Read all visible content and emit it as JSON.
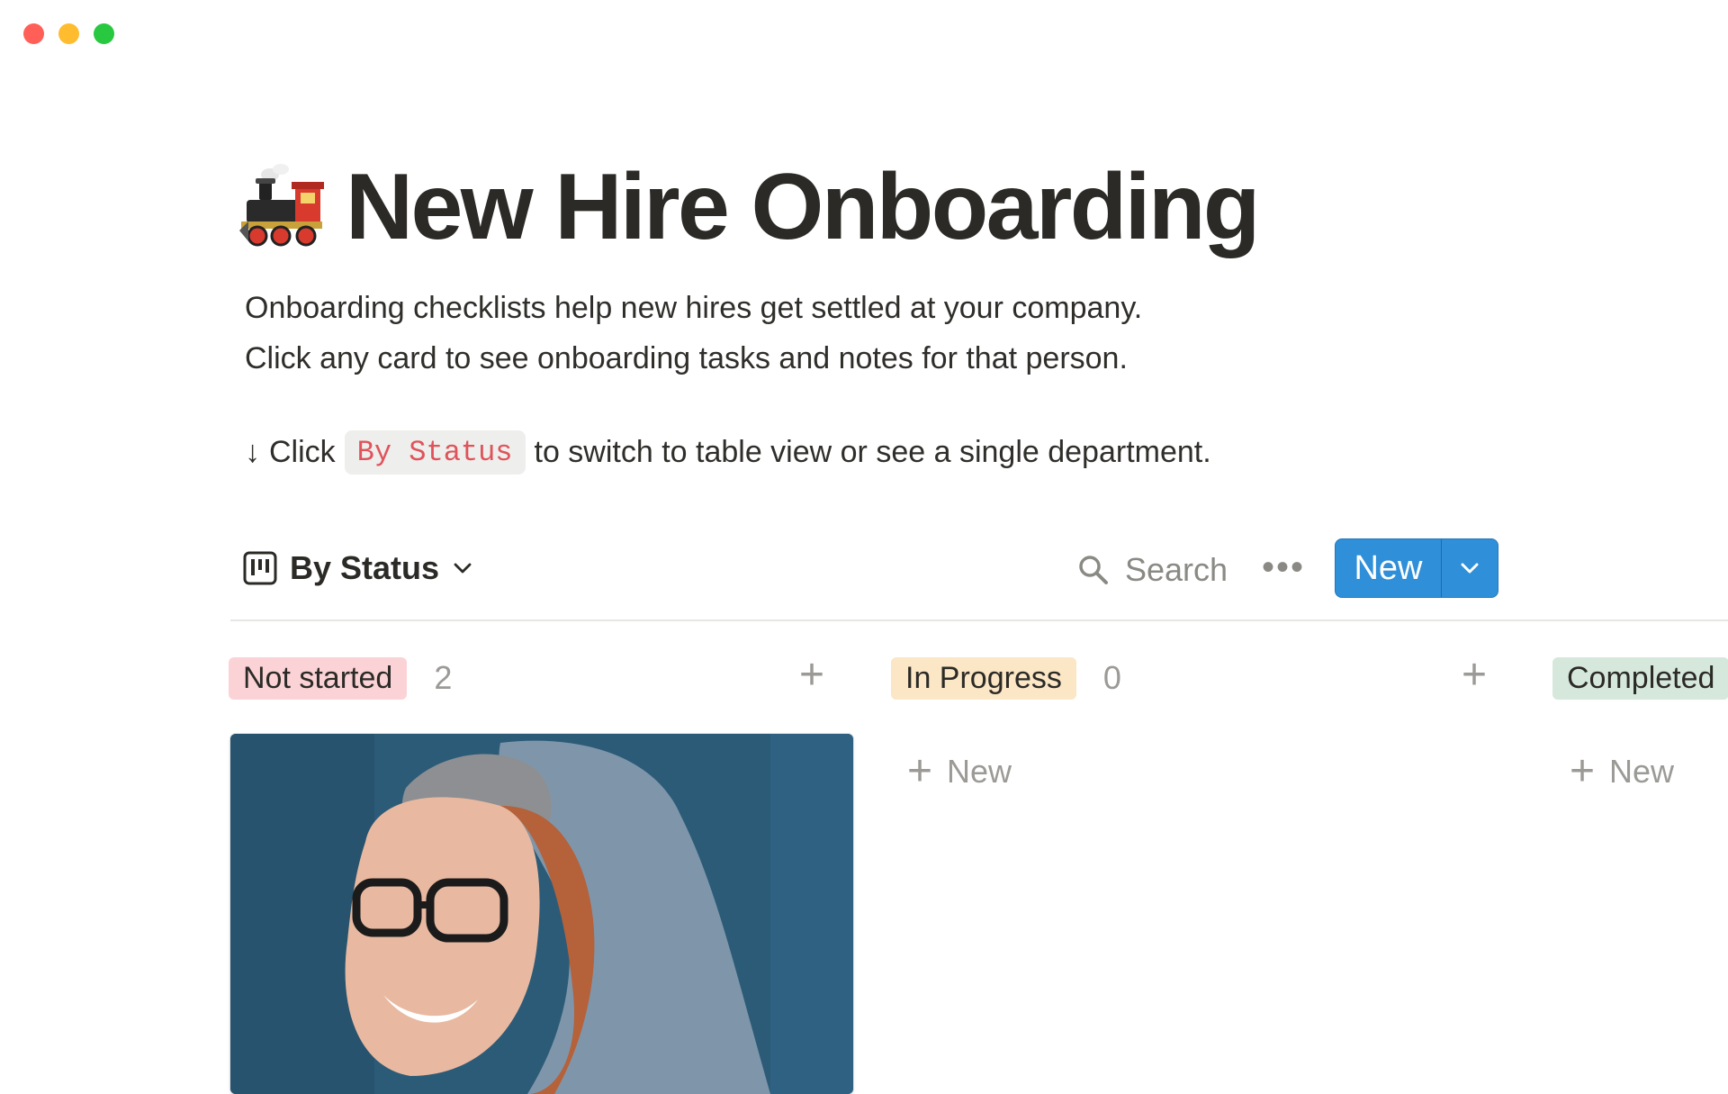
{
  "window": {
    "controls": {
      "close_color": "#ff5f57",
      "minimize_color": "#febc2e",
      "maximize_color": "#28c840"
    }
  },
  "page": {
    "icon": "steam-locomotive-icon",
    "title": "New Hire Onboarding",
    "description": [
      "Onboarding checklists help new hires get settled at your company.",
      "Click any card to see onboarding tasks and notes for that person."
    ],
    "hint": {
      "arrow": "↓",
      "before": "Click",
      "code": "By Status",
      "after": "to switch to table view or see a single department."
    }
  },
  "toolbar": {
    "view_label": "By Status",
    "view_icon": "board-view-icon",
    "search_label": "Search",
    "more_label": "•••",
    "new_label": "New",
    "accent": "#2f8fd8"
  },
  "board": {
    "columns": [
      {
        "label": "Not started",
        "count": "2",
        "chip_color": "#fbd3d6",
        "add_label": "New"
      },
      {
        "label": "In Progress",
        "count": "0",
        "chip_color": "#fbe6c6",
        "add_label": "New"
      },
      {
        "label": "Completed",
        "count": "",
        "chip_color": "#d6e8dc",
        "add_label": "New"
      }
    ]
  }
}
